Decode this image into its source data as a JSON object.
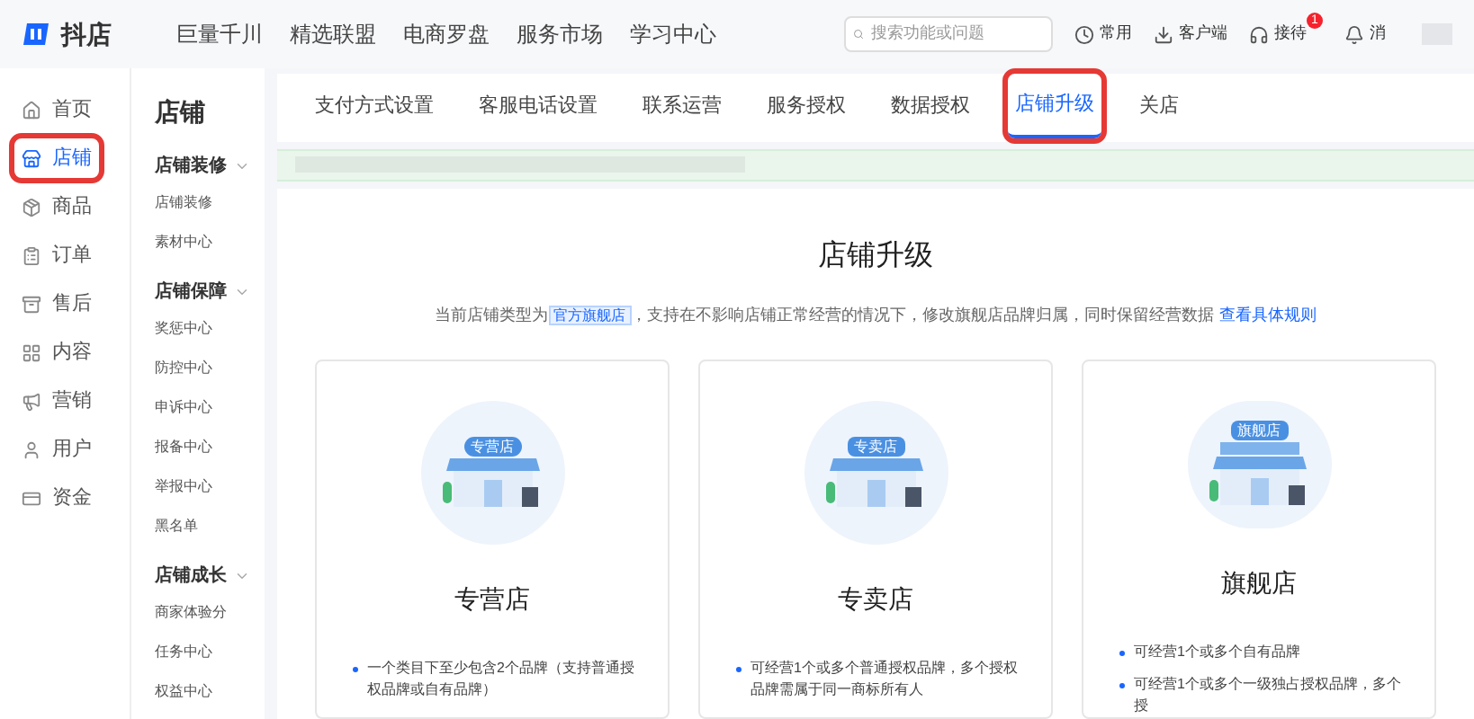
{
  "logo": {
    "text": "抖店"
  },
  "top_nav": [
    "巨量千川",
    "精选联盟",
    "电商罗盘",
    "服务市场",
    "学习中心"
  ],
  "search": {
    "placeholder": "搜索功能或问题"
  },
  "top_actions": [
    {
      "kind": "clock",
      "label": "常用"
    },
    {
      "kind": "download",
      "label": "客户端"
    },
    {
      "kind": "headset",
      "label": "接待",
      "badge": "1"
    },
    {
      "kind": "bell",
      "label": "消"
    }
  ],
  "main_nav": [
    {
      "kind": "home",
      "label": "首页",
      "selected": false,
      "highlight": false
    },
    {
      "kind": "store",
      "label": "店铺",
      "selected": true,
      "highlight": true
    },
    {
      "kind": "goods",
      "label": "商品",
      "selected": false,
      "highlight": false
    },
    {
      "kind": "order",
      "label": "订单",
      "selected": false,
      "highlight": false
    },
    {
      "kind": "aftersale",
      "label": "售后",
      "selected": false,
      "highlight": false
    },
    {
      "kind": "content",
      "label": "内容",
      "selected": false,
      "highlight": false
    },
    {
      "kind": "marketing",
      "label": "营销",
      "selected": false,
      "highlight": false
    },
    {
      "kind": "user",
      "label": "用户",
      "selected": false,
      "highlight": false
    },
    {
      "kind": "funds",
      "label": "资金",
      "selected": false,
      "highlight": false
    }
  ],
  "sub_nav": {
    "title": "店铺",
    "groups": [
      {
        "label": "店铺装修",
        "expanded": true,
        "children": [
          "店铺装修",
          "素材中心"
        ]
      },
      {
        "label": "店铺保障",
        "expanded": true,
        "children": [
          "奖惩中心",
          "防控中心",
          "申诉中心",
          "报备中心",
          "举报中心",
          "黑名单"
        ]
      },
      {
        "label": "店铺成长",
        "expanded": true,
        "children": [
          "商家体验分",
          "任务中心",
          "权益中心"
        ]
      }
    ]
  },
  "tabs": [
    {
      "label": "支付方式设置",
      "selected": false,
      "highlight": false
    },
    {
      "label": "客服电话设置",
      "selected": false,
      "highlight": false
    },
    {
      "label": "联系运营",
      "selected": false,
      "highlight": false
    },
    {
      "label": "服务授权",
      "selected": false,
      "highlight": false
    },
    {
      "label": "数据授权",
      "selected": false,
      "highlight": false
    },
    {
      "label": "店铺升级",
      "selected": true,
      "highlight": true
    },
    {
      "label": "关店",
      "selected": false,
      "highlight": false
    }
  ],
  "page": {
    "title": "店铺升级",
    "intro_before": "当前店铺类型为",
    "current_type": "官方旗舰店",
    "intro_after": "，支持在不影响店铺正常经营的情况下，修改旗舰店品牌归属，同时保留经营数据",
    "rules_link": "查看具体规则"
  },
  "cards": [
    {
      "kind": "oval",
      "sign": "专营店",
      "title": "专营店",
      "bullets": [
        "一个类目下至少包含2个品牌（支持普通授权品牌或自有品牌）"
      ]
    },
    {
      "kind": "rect",
      "sign": "专卖店",
      "title": "专卖店",
      "bullets": [
        "可经营1个或多个普通授权品牌，多个授权品牌需属于同一商标所有人"
      ]
    },
    {
      "kind": "tall",
      "sign": "旗舰店",
      "title": "旗舰店",
      "bullets": [
        "可经营1个或多个自有品牌",
        "可经营1个或多个一级独占授权品牌，多个授"
      ]
    }
  ]
}
